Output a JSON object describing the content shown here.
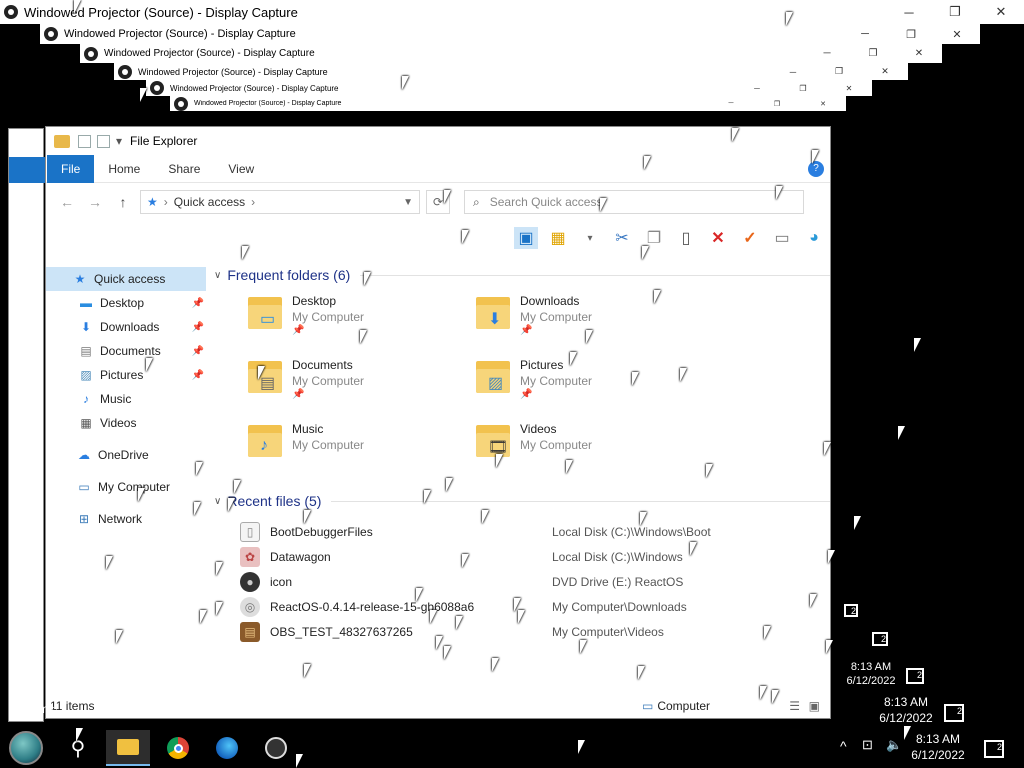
{
  "projector_windows": [
    {
      "title": "Windowed Projector (Source) - Display Capture"
    },
    {
      "title": "Windowed Projector (Source) - Display Capture"
    },
    {
      "title": "Windowed Projector (Source) - Display Capture"
    },
    {
      "title": "Windowed Projector (Source) - Display Capture"
    },
    {
      "title": "Windowed Projector (Source) - Display Capture"
    },
    {
      "title": "Windowed Projector (Source) - Display Capture"
    }
  ],
  "window_controls": {
    "minimize": "─",
    "maximize": "❐",
    "close": "✕"
  },
  "explorer": {
    "title": "File Explorer",
    "ribbon_tabs": [
      "File",
      "Home",
      "Share",
      "View"
    ],
    "help": "?",
    "address": "Quick access",
    "search_placeholder": "Search Quick access",
    "nav": [
      {
        "label": "Quick access",
        "icon": "star-icon"
      },
      {
        "label": "Desktop",
        "icon": "desktop-icon"
      },
      {
        "label": "Downloads",
        "icon": "download-icon"
      },
      {
        "label": "Documents",
        "icon": "document-icon"
      },
      {
        "label": "Pictures",
        "icon": "picture-icon"
      },
      {
        "label": "Music",
        "icon": "music-icon"
      },
      {
        "label": "Videos",
        "icon": "video-icon"
      },
      {
        "label": "OneDrive",
        "icon": "cloud-icon"
      },
      {
        "label": "My Computer",
        "icon": "computer-icon"
      },
      {
        "label": "Network",
        "icon": "network-icon"
      }
    ],
    "frequent_header": "Frequent folders (6)",
    "frequent": [
      {
        "name": "Desktop",
        "location": "My Computer",
        "badge": "▭",
        "pinned": true
      },
      {
        "name": "Downloads",
        "location": "My Computer",
        "badge": "⬇",
        "pinned": true
      },
      {
        "name": "Documents",
        "location": "My Computer",
        "badge": "▤",
        "pinned": true
      },
      {
        "name": "Pictures",
        "location": "My Computer",
        "badge": "▨",
        "pinned": true
      },
      {
        "name": "Music",
        "location": "My Computer",
        "badge": "♪",
        "pinned": false
      },
      {
        "name": "Videos",
        "location": "My Computer",
        "badge": "🎞",
        "pinned": false
      }
    ],
    "recent_header": "Recent files (5)",
    "recent": [
      {
        "name": "BootDebuggerFiles",
        "path": "Local Disk (C:)\\Windows\\Boot"
      },
      {
        "name": "Datawagon",
        "path": "Local Disk (C:)\\Windows"
      },
      {
        "name": "icon",
        "path": "DVD Drive (E:) ReactOS"
      },
      {
        "name": "ReactOS-0.4.14-release-15-gb6088a6",
        "path": "My Computer\\Downloads"
      },
      {
        "name": "OBS_TEST_48327637265",
        "path": "My Computer\\Videos"
      }
    ],
    "status_items": "11 items",
    "status_location": "Computer"
  },
  "taskbar": {
    "time": "8:13 AM",
    "date": "6/12/2022",
    "notification_count": "2"
  },
  "colors": {
    "accent": "#1a73c7",
    "section_header": "#1e3287"
  }
}
